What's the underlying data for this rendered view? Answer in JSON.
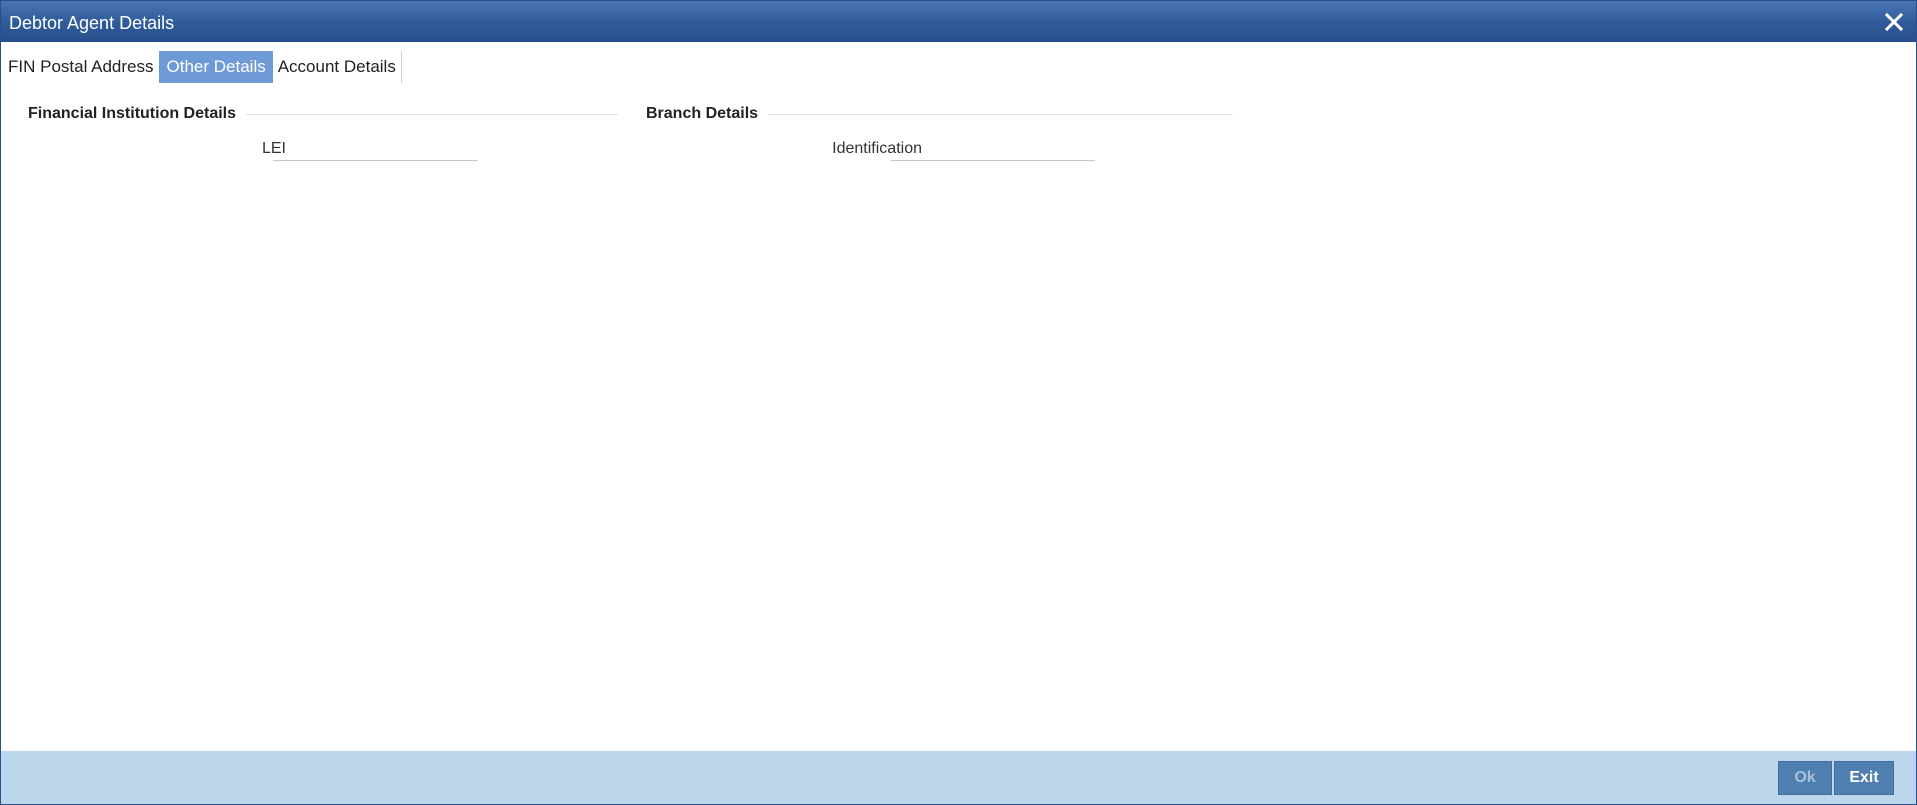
{
  "window": {
    "title": "Debtor Agent Details",
    "close_icon": "close-icon"
  },
  "tabs": [
    {
      "label": "FIN Postal Address",
      "active": false
    },
    {
      "label": "Other Details",
      "active": true
    },
    {
      "label": "Account Details",
      "active": false
    }
  ],
  "financial_institution": {
    "title": "Financial Institution Details",
    "lei_label": "LEI",
    "lei_value": ""
  },
  "branch": {
    "title": "Branch Details",
    "identification_label": "Identification",
    "identification_value": ""
  },
  "footer": {
    "ok_label": "Ok",
    "exit_label": "Exit"
  },
  "colors": {
    "titlebar": "#2f5a9a",
    "active_tab": "#6f9ad8",
    "footer": "#bcd7ec",
    "button": "#4f7fae"
  }
}
